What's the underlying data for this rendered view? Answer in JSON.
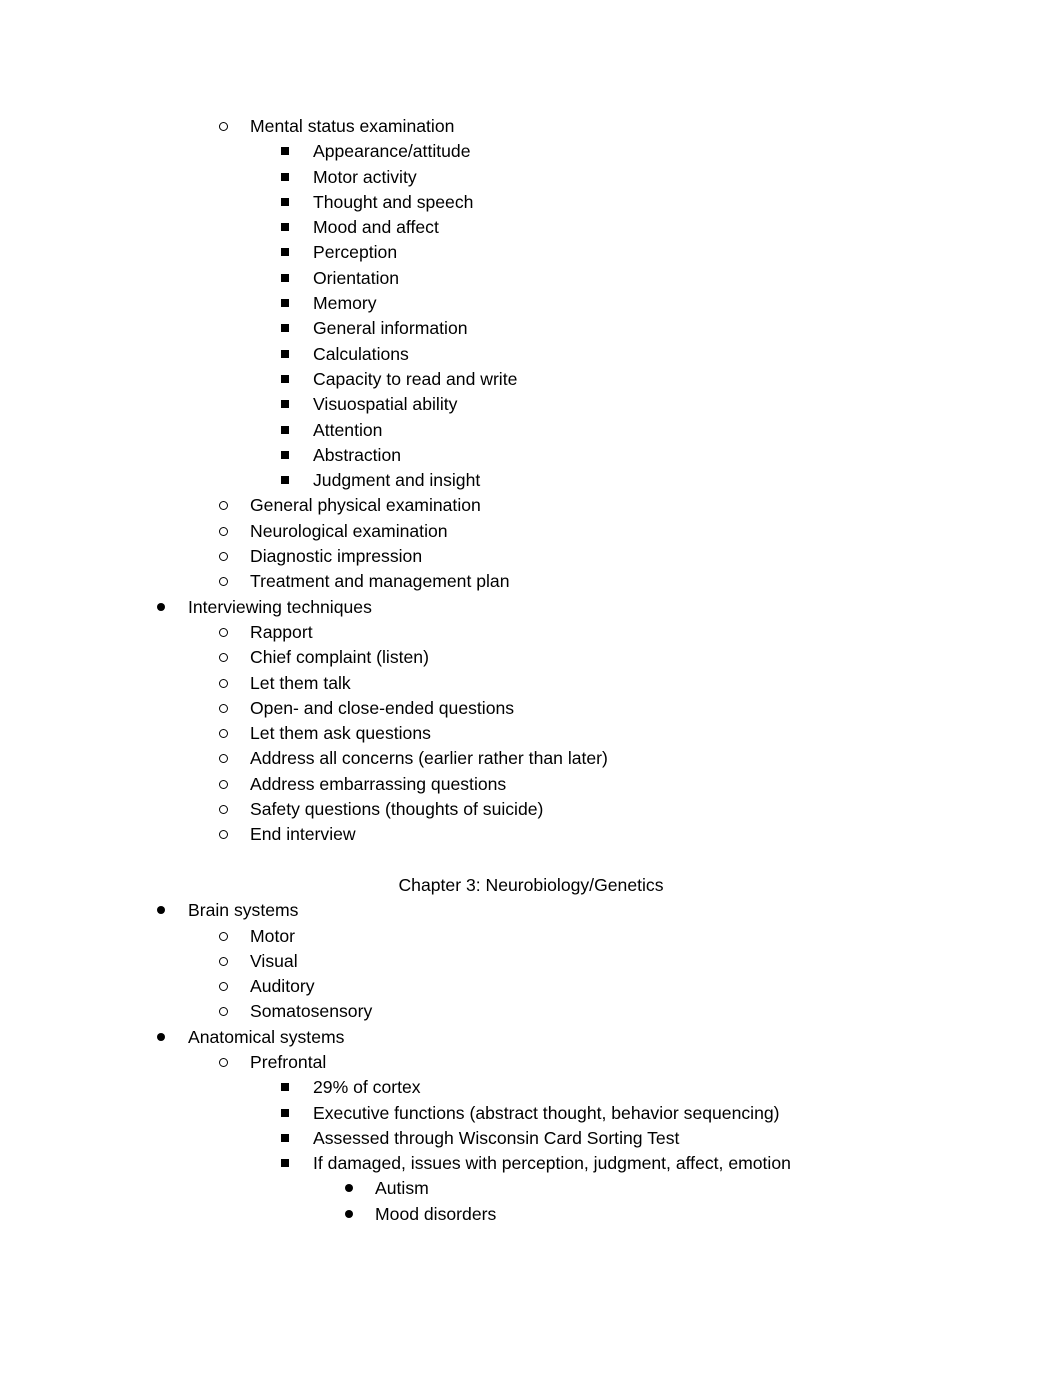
{
  "document": {
    "outline": [
      {
        "level": 2,
        "bullet": "hollow-circle",
        "text": "Mental status examination"
      },
      {
        "level": 3,
        "bullet": "filled-square",
        "text": "Appearance/attitude"
      },
      {
        "level": 3,
        "bullet": "filled-square",
        "text": "Motor activity"
      },
      {
        "level": 3,
        "bullet": "filled-square",
        "text": "Thought and speech"
      },
      {
        "level": 3,
        "bullet": "filled-square",
        "text": "Mood and affect"
      },
      {
        "level": 3,
        "bullet": "filled-square",
        "text": "Perception"
      },
      {
        "level": 3,
        "bullet": "filled-square",
        "text": "Orientation"
      },
      {
        "level": 3,
        "bullet": "filled-square",
        "text": "Memory"
      },
      {
        "level": 3,
        "bullet": "filled-square",
        "text": "General information"
      },
      {
        "level": 3,
        "bullet": "filled-square",
        "text": "Calculations"
      },
      {
        "level": 3,
        "bullet": "filled-square",
        "text": "Capacity to read and write"
      },
      {
        "level": 3,
        "bullet": "filled-square",
        "text": "Visuospatial ability"
      },
      {
        "level": 3,
        "bullet": "filled-square",
        "text": "Attention"
      },
      {
        "level": 3,
        "bullet": "filled-square",
        "text": "Abstraction"
      },
      {
        "level": 3,
        "bullet": "filled-square",
        "text": "Judgment and insight"
      },
      {
        "level": 2,
        "bullet": "hollow-circle",
        "text": "General physical examination"
      },
      {
        "level": 2,
        "bullet": "hollow-circle",
        "text": "Neurological examination"
      },
      {
        "level": 2,
        "bullet": "hollow-circle",
        "text": "Diagnostic impression"
      },
      {
        "level": 2,
        "bullet": "hollow-circle",
        "text": "Treatment and management plan"
      },
      {
        "level": 1,
        "bullet": "filled-disc",
        "text": "Interviewing techniques"
      },
      {
        "level": 2,
        "bullet": "hollow-circle",
        "text": "Rapport"
      },
      {
        "level": 2,
        "bullet": "hollow-circle",
        "text": "Chief complaint (listen)"
      },
      {
        "level": 2,
        "bullet": "hollow-circle",
        "text": "Let them talk"
      },
      {
        "level": 2,
        "bullet": "hollow-circle",
        "text": "Open- and close-ended questions"
      },
      {
        "level": 2,
        "bullet": "hollow-circle",
        "text": "Let them ask questions"
      },
      {
        "level": 2,
        "bullet": "hollow-circle",
        "text": "Address all concerns (earlier rather than later)"
      },
      {
        "level": 2,
        "bullet": "hollow-circle",
        "text": "Address embarrassing questions"
      },
      {
        "level": 2,
        "bullet": "hollow-circle",
        "text": "Safety questions (thoughts of suicide)"
      },
      {
        "level": 2,
        "bullet": "hollow-circle",
        "text": "End interview"
      }
    ],
    "chapter_heading": "Chapter 3: Neurobiology/Genetics",
    "outline_after_heading": [
      {
        "level": 1,
        "bullet": "filled-disc",
        "text": "Brain systems"
      },
      {
        "level": 2,
        "bullet": "hollow-circle",
        "text": "Motor"
      },
      {
        "level": 2,
        "bullet": "hollow-circle",
        "text": "Visual"
      },
      {
        "level": 2,
        "bullet": "hollow-circle",
        "text": "Auditory"
      },
      {
        "level": 2,
        "bullet": "hollow-circle",
        "text": "Somatosensory"
      },
      {
        "level": 1,
        "bullet": "filled-disc",
        "text": "Anatomical systems"
      },
      {
        "level": 2,
        "bullet": "hollow-circle",
        "text": "Prefrontal"
      },
      {
        "level": 3,
        "bullet": "filled-square",
        "text": "29% of cortex"
      },
      {
        "level": 3,
        "bullet": "filled-square",
        "text": "Executive functions (abstract thought, behavior sequencing)"
      },
      {
        "level": 3,
        "bullet": "filled-square",
        "text": "Assessed through Wisconsin Card Sorting Test"
      },
      {
        "level": 3,
        "bullet": "filled-square",
        "text": "If damaged, issues with perception, judgment, affect, emotion"
      },
      {
        "level": 4,
        "bullet": "filled-disc",
        "text": "Autism"
      },
      {
        "level": 4,
        "bullet": "filled-disc",
        "text": "Mood disorders"
      }
    ]
  }
}
